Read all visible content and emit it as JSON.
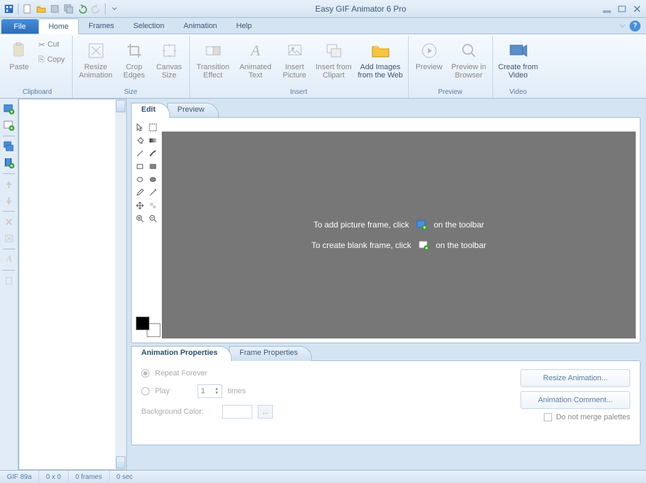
{
  "app_title": "Easy GIF Animator 6 Pro",
  "menu": {
    "file": "File",
    "home": "Home",
    "frames": "Frames",
    "selection": "Selection",
    "animation": "Animation",
    "help": "Help"
  },
  "ribbon": {
    "clipboard": {
      "label": "Clipboard",
      "paste": "Paste",
      "cut": "Cut",
      "copy": "Copy"
    },
    "size": {
      "label": "Size",
      "resize": "Resize Animation",
      "crop": "Crop Edges",
      "canvas": "Canvas Size"
    },
    "insert": {
      "label": "Insert",
      "transition": "Transition Effect",
      "animtext": "Animated Text",
      "picture": "Insert Picture",
      "clipart": "Insert from Clipart",
      "web": "Add Images from the Web"
    },
    "preview": {
      "label": "Preview",
      "preview": "Preview",
      "browser": "Preview in Browser"
    },
    "video": {
      "label": "Video",
      "create": "Create from Video"
    }
  },
  "tabs": {
    "edit": "Edit",
    "preview": "Preview"
  },
  "canvas": {
    "hint1a": "To add picture frame, click",
    "hint1b": "on the toolbar",
    "hint2a": "To create blank frame, click",
    "hint2b": "on the toolbar"
  },
  "props_tabs": {
    "anim": "Animation Properties",
    "frame": "Frame Properties"
  },
  "props": {
    "repeat": "Repeat Forever",
    "play": "Play",
    "play_count": "1",
    "times": "times",
    "bgcolor": "Background Color:",
    "resize_btn": "Resize Animation...",
    "comment_btn": "Animation Comment...",
    "merge": "Do not merge palettes"
  },
  "status": {
    "format": "GIF 89a",
    "size": "0 x 0",
    "frames": "0 frames",
    "time": "0 sec"
  }
}
